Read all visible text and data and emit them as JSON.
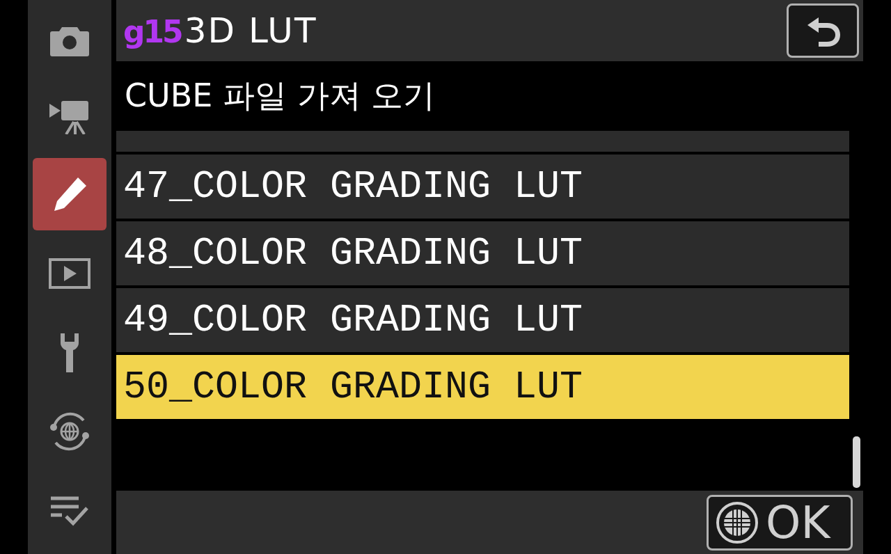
{
  "sidebar": {
    "items": [
      {
        "kind": "camera",
        "selected": false
      },
      {
        "kind": "movie",
        "selected": false
      },
      {
        "kind": "pencil",
        "selected": true
      },
      {
        "kind": "playback",
        "selected": false
      },
      {
        "kind": "wrench",
        "selected": false
      },
      {
        "kind": "network",
        "selected": false
      },
      {
        "kind": "checklist",
        "selected": false
      }
    ]
  },
  "header": {
    "code": "g15",
    "title": "3D LUT"
  },
  "subtitle": "CUBE 파일 가져 오기",
  "list": {
    "rows": [
      {
        "label": "47_COLOR GRADING LUT",
        "selected": false
      },
      {
        "label": "48_COLOR GRADING LUT",
        "selected": false
      },
      {
        "label": "49_COLOR GRADING LUT",
        "selected": false
      },
      {
        "label": "50_COLOR GRADING LUT",
        "selected": true
      }
    ]
  },
  "footer": {
    "ok_label": "OK"
  }
}
